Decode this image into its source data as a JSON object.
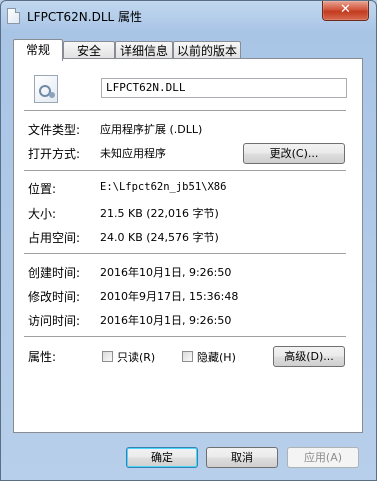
{
  "window": {
    "title": "LFPCT62N.DLL 属性",
    "close_symbol": "✕"
  },
  "tabs": [
    {
      "label": "常规"
    },
    {
      "label": "安全"
    },
    {
      "label": "详细信息"
    },
    {
      "label": "以前的版本"
    }
  ],
  "general": {
    "filename": "LFPCT62N.DLL",
    "file_type_label": "文件类型:",
    "file_type_value": "应用程序扩展 (.DLL)",
    "opens_with_label": "打开方式:",
    "opens_with_value": "未知应用程序",
    "change_button": "更改(C)...",
    "location_label": "位置:",
    "location_value": "E:\\Lfpct62n_jb51\\X86",
    "size_label": "大小:",
    "size_value": "21.5 KB (22,016 字节)",
    "size_on_disk_label": "占用空间:",
    "size_on_disk_value": "24.0 KB (24,576 字节)",
    "created_label": "创建时间:",
    "created_value": "2016年10月1日, 9:26:50",
    "modified_label": "修改时间:",
    "modified_value": "2010年9月17日, 15:36:48",
    "accessed_label": "访问时间:",
    "accessed_value": "2016年10月1日, 9:26:50",
    "attributes_label": "属性:",
    "readonly_label": "只读(R)",
    "hidden_label": "隐藏(H)",
    "advanced_button": "高级(D)..."
  },
  "footer": {
    "ok": "确定",
    "cancel": "取消",
    "apply": "应用(A)"
  }
}
